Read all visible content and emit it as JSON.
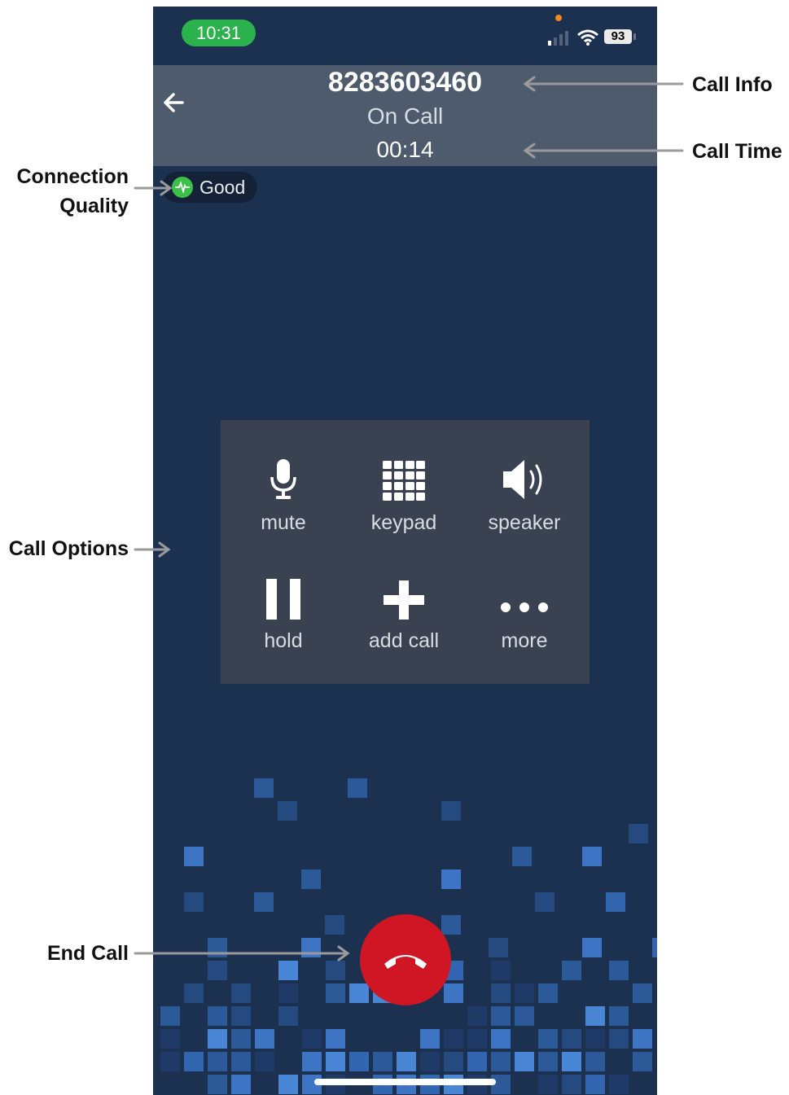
{
  "status_bar": {
    "time": "10:31",
    "battery": "93"
  },
  "call": {
    "number": "8283603460",
    "status": "On Call",
    "timer": "00:14"
  },
  "connection": {
    "quality_label": "Good",
    "quality_color": "#3cc04a"
  },
  "options": {
    "mute": "mute",
    "keypad": "keypad",
    "speaker": "speaker",
    "hold": "hold",
    "add_call": "add call",
    "more": "more"
  },
  "end_call_color": "#d01624",
  "annotations": {
    "call_info": "Call Info",
    "call_time": "Call Time",
    "connection_quality_line1": "Connection",
    "connection_quality_line2": "Quality",
    "call_options": "Call Options",
    "end_call": "End Call"
  }
}
